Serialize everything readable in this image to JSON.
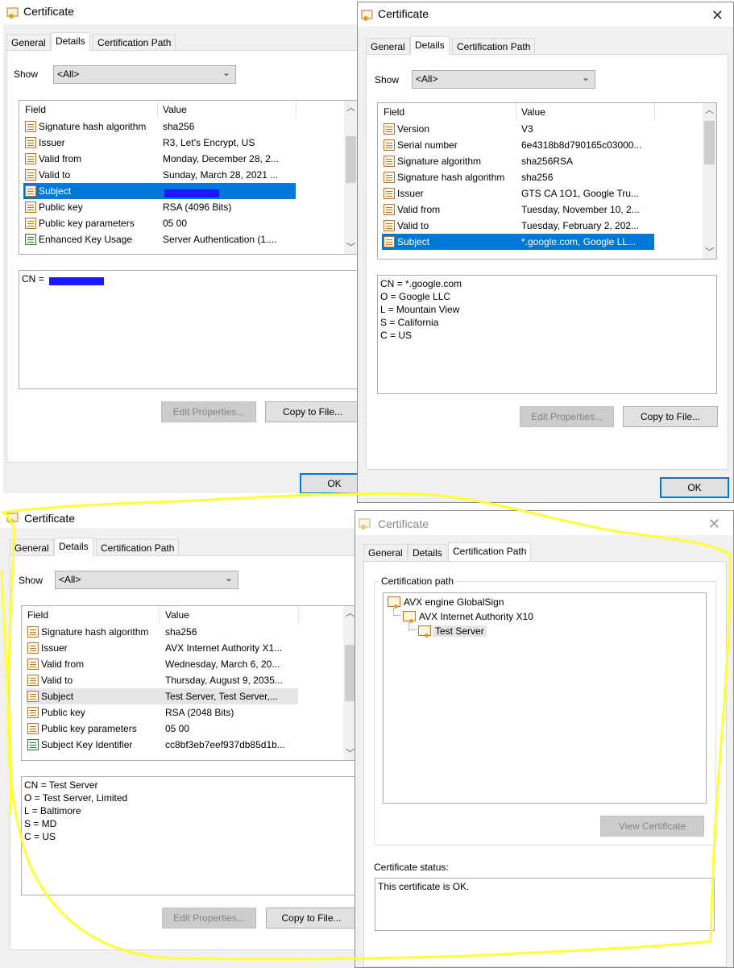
{
  "dialog_title": "Certificate",
  "tabs": {
    "general": "General",
    "details": "Details",
    "path": "Certification Path"
  },
  "show_label": "Show",
  "show_value": "<All>",
  "columns": {
    "field": "Field",
    "value": "Value"
  },
  "buttons": {
    "edit": "Edit Properties...",
    "copy": "Copy to File...",
    "ok": "OK",
    "view": "View Certificate"
  },
  "dialog1": {
    "rows": [
      {
        "field": "Signature hash algorithm",
        "value": "sha256"
      },
      {
        "field": "Issuer",
        "value": "R3, Let's Encrypt, US"
      },
      {
        "field": "Valid from",
        "value": "Monday, December 28, 2..."
      },
      {
        "field": "Valid to",
        "value": "Sunday, March 28, 2021 ..."
      },
      {
        "field": "Subject",
        "value": ""
      },
      {
        "field": "Public key",
        "value": "RSA (4096 Bits)"
      },
      {
        "field": "Public key parameters",
        "value": "05 00"
      },
      {
        "field": "Enhanced Key Usage",
        "value": "Server Authentication (1...."
      }
    ],
    "detail": "CN = "
  },
  "dialog2": {
    "rows": [
      {
        "field": "Version",
        "value": "V3"
      },
      {
        "field": "Serial number",
        "value": "6e4318b8d790165c03000..."
      },
      {
        "field": "Signature algorithm",
        "value": "sha256RSA"
      },
      {
        "field": "Signature hash algorithm",
        "value": "sha256"
      },
      {
        "field": "Issuer",
        "value": "GTS CA 1O1, Google Tru..."
      },
      {
        "field": "Valid from",
        "value": "Tuesday, November 10, 2..."
      },
      {
        "field": "Valid to",
        "value": "Tuesday, February 2, 202..."
      },
      {
        "field": "Subject",
        "value": "*.google.com, Google LL..."
      }
    ],
    "detail": "CN = *.google.com\nO = Google LLC\nL = Mountain View\nS = California\nC = US"
  },
  "dialog3": {
    "rows": [
      {
        "field": "Signature hash algorithm",
        "value": "sha256"
      },
      {
        "field": "Issuer",
        "value": "AVX Internet Authority X1..."
      },
      {
        "field": "Valid from",
        "value": "Wednesday, March 6, 20..."
      },
      {
        "field": "Valid to",
        "value": "Thursday, August 9, 2035..."
      },
      {
        "field": "Subject",
        "value": "Test Server, Test Server,..."
      },
      {
        "field": "Public key",
        "value": "RSA (2048 Bits)"
      },
      {
        "field": "Public key parameters",
        "value": "05 00"
      },
      {
        "field": "Subject Key Identifier",
        "value": "cc8bf3eb7eef937db85d1b..."
      }
    ],
    "detail": "CN = Test Server\nO = Test Server, Limited\nL = Baltimore\nS = MD\nC = US"
  },
  "dialog4": {
    "path_label": "Certification path",
    "tree": [
      "AVX engine GlobalSign",
      "AVX Internet Authority X10",
      "Test Server"
    ],
    "status_label": "Certificate status:",
    "status_text": "This certificate is OK."
  },
  "colors": {
    "selection": "#0078d7",
    "annotation": "#ffff33",
    "redaction": "#1a1aff"
  }
}
